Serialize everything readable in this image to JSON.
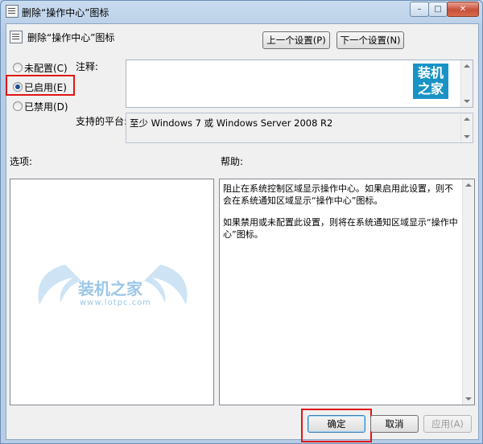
{
  "window": {
    "title": "删除“操作中心”图标",
    "controls": [
      "minimize-icon",
      "maximize-icon",
      "close-icon"
    ]
  },
  "header": {
    "setting_name": "删除“操作中心”图标",
    "prev_button": "上一个设置(P)",
    "next_button": "下一个设置(N)"
  },
  "options": {
    "not_configured": "未配置(C)",
    "enabled": "已启用(E)",
    "disabled": "已禁用(D)",
    "selected": "enabled"
  },
  "comment": {
    "label": "注释:",
    "value": ""
  },
  "platform": {
    "label": "支持的平台:",
    "value": "至少 Windows 7 或 Windows Server 2008 R2"
  },
  "sections": {
    "options_label": "选项:",
    "help_label": "帮助:"
  },
  "help": {
    "paragraph1": "阻止在系统控制区域显示操作中心。如果启用此设置，则不会在系统通知区域显示“操作中心”图标。",
    "paragraph2": "如果禁用或未配置此设置，则将在系统通知区域显示“操作中心”图标。"
  },
  "watermark": {
    "logo_line1": "装机",
    "logo_line2": "之家",
    "brand": "装机之家",
    "url": "www.lotpc.com"
  },
  "footer": {
    "ok": "确定",
    "cancel": "取消",
    "apply": "应用(A)"
  },
  "colors": {
    "highlight": "#e11515",
    "logo": "#1993c6"
  }
}
